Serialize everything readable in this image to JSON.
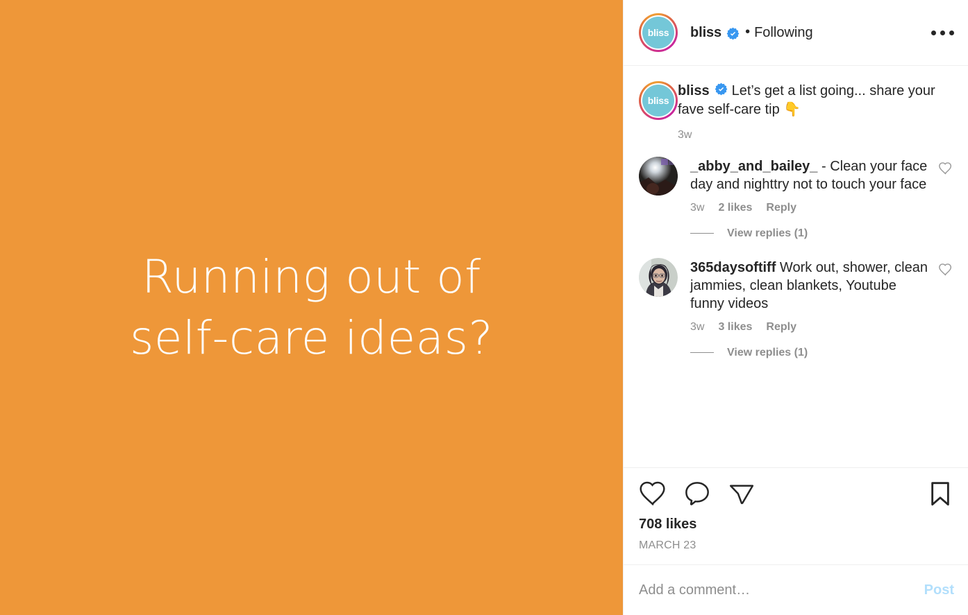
{
  "colors": {
    "media_background": "#ee9739",
    "media_text": "#fdfdfb",
    "verified_blue": "#3897f0",
    "text_primary": "#262626",
    "text_secondary": "#8e8e8e",
    "post_button": "#b2dffc",
    "divider": "#efefef",
    "avatar_bliss_fill": "#74c7d8"
  },
  "media": {
    "line1": "Running out of",
    "line2": "self-care ideas?",
    "alt": "Orange graphic with text Running out of self-care ideas?"
  },
  "header": {
    "avatar_label": "bliss",
    "username": "bliss",
    "verified_icon": "verified-badge-icon",
    "separator": "•",
    "follow_state": "Following",
    "menu_icon": "more-options-icon"
  },
  "caption": {
    "avatar_label": "bliss",
    "username": "bliss",
    "verified_icon": "verified-badge-icon",
    "text": "Let’s get a list going... share your fave self-care tip ",
    "emoji": "👇",
    "timestamp": "3w"
  },
  "comments": [
    {
      "avatar_icon": "user-avatar-photo",
      "username": "_abby_and_bailey_",
      "text": " - Clean your face day and nighttry not to touch your face",
      "timestamp": "3w",
      "likes": "2 likes",
      "reply_label": "Reply",
      "view_replies": "View replies (1)",
      "like_icon": "heart-outline-icon"
    },
    {
      "avatar_icon": "user-avatar-photo",
      "username": "365daysoftiff",
      "text": " Work out, shower, clean jammies, clean blankets, Youtube funny videos",
      "timestamp": "3w",
      "likes": "3 likes",
      "reply_label": "Reply",
      "view_replies": "View replies (1)",
      "like_icon": "heart-outline-icon"
    }
  ],
  "actions": {
    "like_icon": "heart-outline-icon",
    "comment_icon": "comment-bubble-icon",
    "share_icon": "share-paper-plane-icon",
    "save_icon": "bookmark-outline-icon",
    "likes_count": "708 likes",
    "post_date": "MARCH 23"
  },
  "add_comment": {
    "placeholder": "Add a comment…",
    "value": "",
    "post_label": "Post"
  }
}
